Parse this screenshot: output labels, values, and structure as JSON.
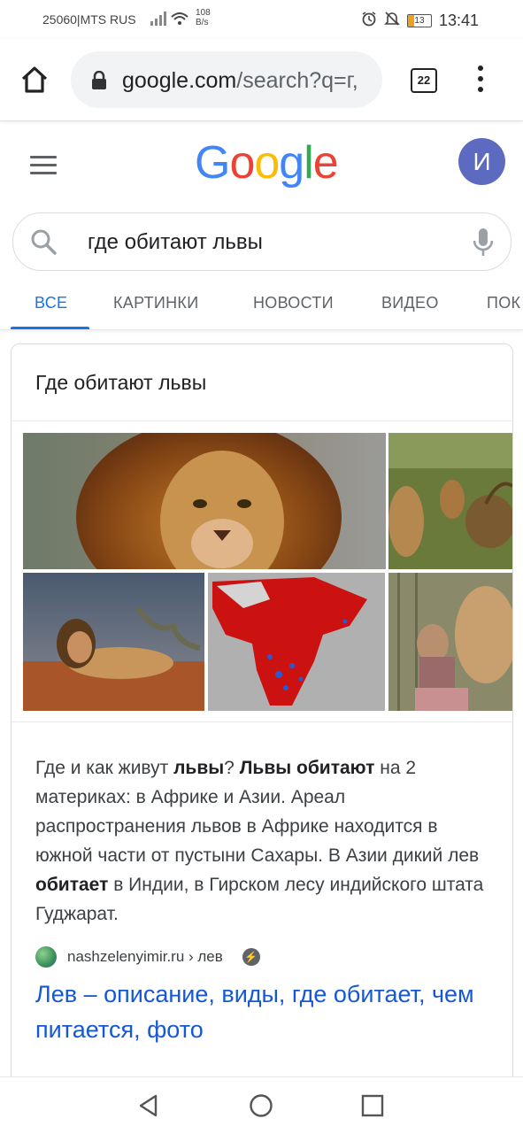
{
  "status_bar": {
    "carrier": "25060|MTS RUS",
    "speed_value": "108",
    "speed_unit": "B/s",
    "battery": "13",
    "time": "13:41"
  },
  "browser": {
    "url_host": "google.com",
    "url_path": "/search?q=г,",
    "tab_count": "22"
  },
  "google": {
    "logo_letters": [
      "G",
      "o",
      "o",
      "g",
      "l",
      "e"
    ],
    "logo_colors": [
      "#4285F4",
      "#EA4335",
      "#FBBC05",
      "#4285F4",
      "#34A853",
      "#EA4335"
    ],
    "avatar_letter": "И",
    "query": "где обитают львы"
  },
  "tabs": [
    "ВСЕ",
    "КАРТИНКИ",
    "НОВОСТИ",
    "ВИДЕО",
    "ПОК"
  ],
  "card": {
    "title": "Где обитают львы",
    "snippet_parts": [
      {
        "text": "Где и как живут ",
        "bold": false
      },
      {
        "text": "львы",
        "bold": true
      },
      {
        "text": "? ",
        "bold": false
      },
      {
        "text": "Львы обитают",
        "bold": true
      },
      {
        "text": " на 2 материках: в Африке и Азии. Ареал распространения львов в Африке находится в южной части от пустыни Сахары. В Азии дикий лев ",
        "bold": false
      },
      {
        "text": "обитает",
        "bold": true
      },
      {
        "text": " в Индии, в Гирском лесу индийского штата Гуджарат.",
        "bold": false
      }
    ],
    "source": "nashzelenyimir.ru › лев",
    "link_title": "Лев – описание, виды, где обитает, чем питается, фото"
  },
  "colors": {
    "accent": "#1a73e8",
    "link": "#1558d6",
    "avatar_bg": "#5c6bc0"
  }
}
